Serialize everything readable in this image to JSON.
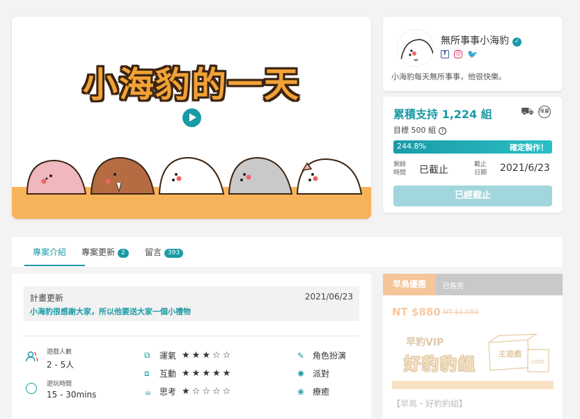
{
  "hero": {
    "title": "小海豹的一天"
  },
  "creator": {
    "name": "無所事事小海豹",
    "socials": [
      {
        "icon": "facebook-icon",
        "glyph": "f"
      },
      {
        "icon": "instagram-icon",
        "glyph": "◎"
      },
      {
        "icon": "twitter-icon",
        "glyph": "🐦"
      }
    ],
    "description": "小海豹每天無所事事，他很快樂。"
  },
  "funding": {
    "raised": "累積支持 1,224 組",
    "limited_label": "限量",
    "goal": "目標 500 組",
    "progress_label": "244.8%",
    "progress_value": 2.448,
    "success_label": "確定製作！",
    "remaining_label": "剩餘時間",
    "remaining_value": "已截止",
    "end_label": "截止日期",
    "end_value": "2021/6/23",
    "button_label": "已經截止"
  },
  "tabs": [
    {
      "label": "專案介紹"
    },
    {
      "label": "專案更新",
      "badge": "2"
    },
    {
      "label": "留言",
      "badge": "393"
    }
  ],
  "update": {
    "label": "計畫更新",
    "date": "2021/06/23",
    "text": "小海豹很感謝大家，所以他要送大家一個小禮物"
  },
  "game_info": {
    "players_label": "遊戲人數",
    "players_value": "2 - 5人",
    "time_label": "遊玩時間",
    "time_value": "15 - 30mins"
  },
  "ratings": [
    {
      "label": "運氣",
      "stars": "★★★☆☆"
    },
    {
      "label": "互動",
      "stars": "★★★★★"
    },
    {
      "label": "思考",
      "stars": "★☆☆☆☆"
    }
  ],
  "tags": [
    {
      "label": "角色扮演"
    },
    {
      "label": "派對"
    },
    {
      "label": "療癒"
    }
  ],
  "reward": {
    "badge": "早鳥優惠",
    "soldout": "已售完",
    "price": "NT $880",
    "old_price": "NT $1,050",
    "vip": "早豹VIP",
    "title_art": "好豹豹組",
    "box_label": "主遊戲",
    "box_small": "小物包",
    "name": "【早鳥・好豹豹組】"
  }
}
